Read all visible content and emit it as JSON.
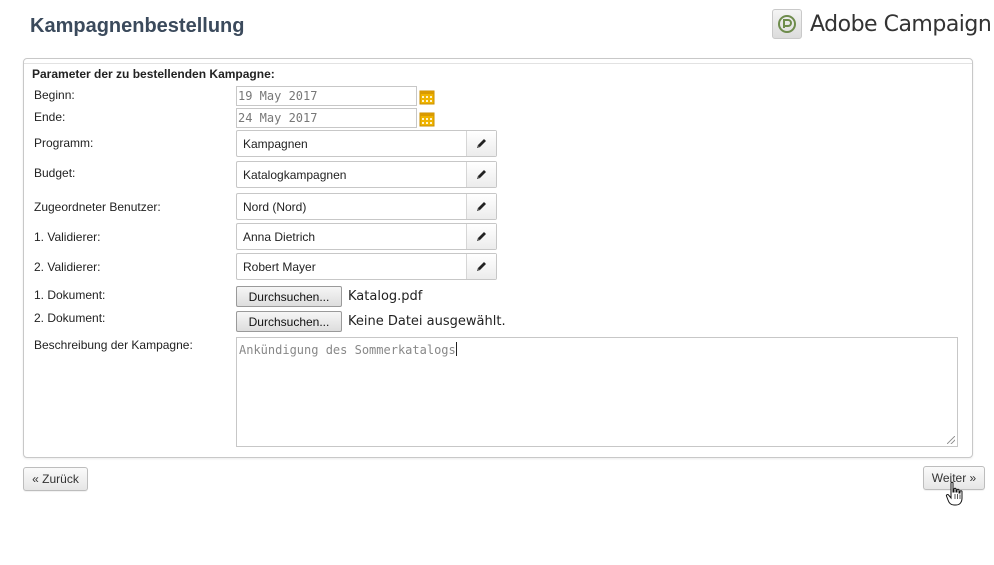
{
  "header": {
    "title": "Kampagnenbestellung",
    "brand_name": "Adobe Campaign"
  },
  "form": {
    "section_title": "Parameter der zu bestellenden Kampagne:",
    "start": {
      "label": "Beginn:",
      "value": "19 May 2017"
    },
    "end": {
      "label": "Ende:",
      "value": "24 May 2017"
    },
    "program": {
      "label": "Programm:",
      "value": "Kampagnen"
    },
    "budget": {
      "label": "Budget:",
      "value": "Katalogkampagnen"
    },
    "assigned_user": {
      "label": "Zugeordneter Benutzer:",
      "value": "Nord (Nord)"
    },
    "validator1": {
      "label": "1. Validierer:",
      "value": "Anna Dietrich"
    },
    "validator2": {
      "label": "2. Validierer:",
      "value": "Robert Mayer"
    },
    "document1": {
      "label": "1. Dokument:",
      "button": "Durchsuchen...",
      "filename": "Katalog.pdf"
    },
    "document2": {
      "label": "2. Dokument:",
      "button": "Durchsuchen...",
      "filename": "Keine Datei ausgewählt."
    },
    "description": {
      "label": "Beschreibung der Kampagne:",
      "value": "Ankündigung des Sommerkatalogs"
    }
  },
  "nav": {
    "back_label": "« Zurück",
    "next_label": "Weiter »"
  },
  "icons": {
    "calendar": "calendar-icon",
    "edit": "pencil-icon",
    "brand": "adobe-campaign-logo"
  },
  "colors": {
    "title": "#3b4a5c",
    "calendar": "#e8b300"
  }
}
